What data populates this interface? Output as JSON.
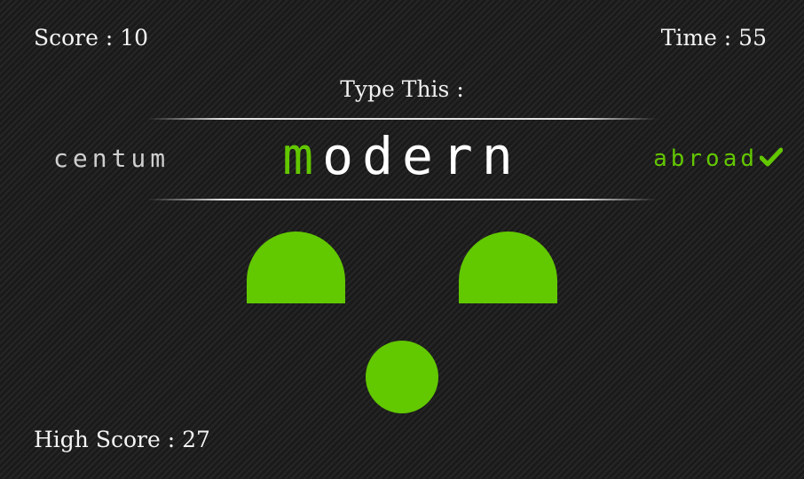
{
  "hud": {
    "score_label": "Score : 10",
    "time_label": "Time : 55",
    "high_score_label": "High Score : 27"
  },
  "prompt": {
    "label": "Type This :",
    "previous_word": "centum",
    "current_word_typed": "m",
    "current_word_remaining": "odern",
    "next_word": "abroad",
    "next_word_status_icon": "checkmark-icon"
  },
  "colors": {
    "accent_green": "#63c700",
    "text_white": "#ffffff",
    "text_gray": "#cfcfcf",
    "background": "#1b1b1b"
  },
  "mascot": {
    "parts": [
      "left-eye",
      "right-eye",
      "mouth"
    ]
  }
}
